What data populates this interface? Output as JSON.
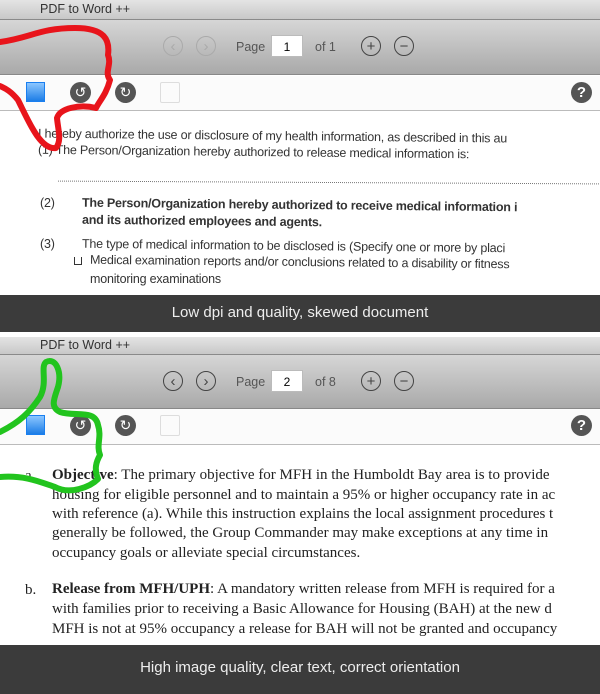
{
  "app_title": "PDF to Word ++",
  "page_label": "Page",
  "panels": [
    {
      "page": "1",
      "of": "of 1",
      "caption": "Low dpi and quality, skewed document",
      "lines": [
        "I hereby authorize the use or disclosure of my health information, as described in this au",
        "(1)       The Person/Organization hereby authorized to release medical information is:",
        "(2)",
        "The Person/Organization hereby authorized to receive medical information i",
        "and its authorized employees and agents.",
        "(3)",
        "The type of medical information to be disclosed is (Specify one or more by placi",
        "Medical examination reports and/or conclusions related to a disability or fitness",
        "monitoring examinations"
      ],
      "hand_color": "#e8141b",
      "hand": "thumbs-down"
    },
    {
      "page": "2",
      "of": "of 8",
      "caption": "High image quality, clear text, correct orientation",
      "lines": [
        "a.",
        "Objective",
        ": The primary objective for MFH in the Humboldt Bay area is to provide",
        "housing for eligible personnel and to maintain a 95% or higher occupancy rate in ac",
        "with reference (a). While this instruction explains the local assignment procedures t",
        "generally be followed, the Group Commander may make exceptions at any time in",
        "occupancy goals or alleviate special circumstances.",
        "b.",
        "Release from MFH/UPH",
        ": A mandatory written release from MFH is required for a",
        "with families prior to receiving a Basic Allowance for Housing (BAH) at the new d",
        "MFH is not at 95% occupancy a release for BAH will not be granted and occupancy"
      ],
      "hand_color": "#22c41e",
      "hand": "thumbs-up"
    }
  ],
  "icons": {
    "prev": "chevron-left-icon",
    "next": "chevron-right-icon",
    "zoom_in": "plus-circle-icon",
    "zoom_out": "minus-circle-icon",
    "image": "image-select-icon",
    "rotate_left": "rotate-left-icon",
    "rotate_right": "rotate-right-icon",
    "remove": "remove-image-icon",
    "help": "help-icon"
  }
}
